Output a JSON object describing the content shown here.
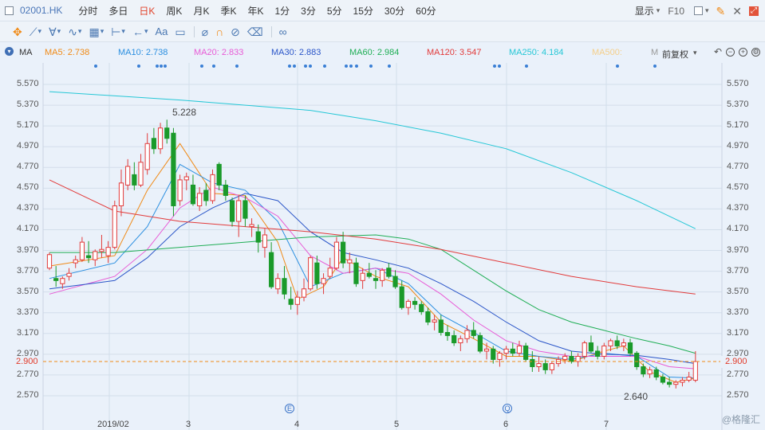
{
  "header": {
    "stock_code": "02001.HK",
    "tabs": [
      {
        "label": "分时",
        "active": false
      },
      {
        "label": "多日",
        "active": false
      },
      {
        "label": "日K",
        "active": true
      },
      {
        "label": "周K",
        "active": false
      },
      {
        "label": "月K",
        "active": false
      },
      {
        "label": "季K",
        "active": false
      },
      {
        "label": "年K",
        "active": false
      },
      {
        "label": "1分",
        "active": false
      },
      {
        "label": "3分",
        "active": false
      },
      {
        "label": "5分",
        "active": false
      },
      {
        "label": "15分",
        "active": false
      },
      {
        "label": "30分",
        "active": false
      },
      {
        "label": "60分",
        "active": false
      }
    ],
    "display_label": "显示",
    "f10_label": "F10"
  },
  "toolbar": {
    "font_label": "Aa"
  },
  "indicator": {
    "name": "MA",
    "adjust_label": "前复权",
    "items": [
      {
        "label": "MA5: 2.738",
        "color": "#f08a16"
      },
      {
        "label": "MA10: 2.738",
        "color": "#2b8fe0"
      },
      {
        "label": "MA20: 2.833",
        "color": "#e85bd6"
      },
      {
        "label": "MA30: 2.883",
        "color": "#2a55c8"
      },
      {
        "label": "MA60: 2.984",
        "color": "#1fae55"
      },
      {
        "label": "MA120: 3.547",
        "color": "#e23b3b"
      },
      {
        "label": "MA250: 4.184",
        "color": "#25c7d6"
      },
      {
        "label": "MA500:",
        "color": "#f5cf8a"
      },
      {
        "label": "M",
        "color": "#999999"
      }
    ]
  },
  "chart_data": {
    "type": "candlestick",
    "y_ticks": [
      "5.570",
      "5.370",
      "5.170",
      "4.970",
      "4.770",
      "4.570",
      "4.370",
      "4.170",
      "3.970",
      "3.770",
      "3.570",
      "3.370",
      "3.170",
      "2.970",
      "2.770",
      "2.570"
    ],
    "x_labels": [
      "2019/02",
      "3",
      "4",
      "5",
      "6",
      "7"
    ],
    "current_price": "2.900",
    "high_label": "5.228",
    "low_label": "2.640",
    "ylim": [
      2.48,
      5.68
    ],
    "event_markers": [
      "E",
      "Q"
    ],
    "colors": {
      "up": "#e23b3b",
      "down": "#1a9a2a"
    },
    "ohlc": [
      [
        3.8,
        3.95,
        3.78,
        3.93
      ],
      [
        3.7,
        3.82,
        3.62,
        3.68
      ],
      [
        3.65,
        3.72,
        3.6,
        3.7
      ],
      [
        3.72,
        3.8,
        3.68,
        3.75
      ],
      [
        3.85,
        3.92,
        3.8,
        3.88
      ],
      [
        3.88,
        4.1,
        3.86,
        4.05
      ],
      [
        3.92,
        4.06,
        3.85,
        3.9
      ],
      [
        3.88,
        3.98,
        3.82,
        3.96
      ],
      [
        3.96,
        4.12,
        3.9,
        3.98
      ],
      [
        3.92,
        4.06,
        3.85,
        4.0
      ],
      [
        4.0,
        4.45,
        3.98,
        4.4
      ],
      [
        4.4,
        4.75,
        4.3,
        4.62
      ],
      [
        4.6,
        4.85,
        4.55,
        4.78
      ],
      [
        4.7,
        4.82,
        4.55,
        4.6
      ],
      [
        4.6,
        4.9,
        4.58,
        4.82
      ],
      [
        4.75,
        5.1,
        4.7,
        5.0
      ],
      [
        5.05,
        5.15,
        4.9,
        4.95
      ],
      [
        4.95,
        5.2,
        4.9,
        5.15
      ],
      [
        5.15,
        5.23,
        5.0,
        5.05
      ],
      [
        5.1,
        5.15,
        4.3,
        4.4
      ],
      [
        4.45,
        4.7,
        4.4,
        4.65
      ],
      [
        4.65,
        4.72,
        4.55,
        4.68
      ],
      [
        4.6,
        4.7,
        4.4,
        4.42
      ],
      [
        4.4,
        4.58,
        4.35,
        4.52
      ],
      [
        4.55,
        4.62,
        4.4,
        4.45
      ],
      [
        4.45,
        4.75,
        4.42,
        4.7
      ],
      [
        4.8,
        4.82,
        4.55,
        4.6
      ],
      [
        4.6,
        4.65,
        4.45,
        4.5
      ],
      [
        4.45,
        4.48,
        4.2,
        4.25
      ],
      [
        4.25,
        4.5,
        4.1,
        4.45
      ],
      [
        4.45,
        4.5,
        4.2,
        4.28
      ],
      [
        4.2,
        4.28,
        4.1,
        4.22
      ],
      [
        4.15,
        4.22,
        3.95,
        4.05
      ],
      [
        4.0,
        4.18,
        3.9,
        4.12
      ],
      [
        3.95,
        4.05,
        3.6,
        3.62
      ],
      [
        3.6,
        3.75,
        3.55,
        3.7
      ],
      [
        3.7,
        3.82,
        3.5,
        3.55
      ],
      [
        3.5,
        3.62,
        3.4,
        3.45
      ],
      [
        3.45,
        3.58,
        3.35,
        3.52
      ],
      [
        3.52,
        3.7,
        3.48,
        3.6
      ],
      [
        3.6,
        3.92,
        3.58,
        3.9
      ],
      [
        3.85,
        3.92,
        3.6,
        3.65
      ],
      [
        3.65,
        3.75,
        3.55,
        3.7
      ],
      [
        3.72,
        3.9,
        3.7,
        3.8
      ],
      [
        3.8,
        4.1,
        3.78,
        4.05
      ],
      [
        4.05,
        4.15,
        3.8,
        3.85
      ],
      [
        3.85,
        3.95,
        3.75,
        3.88
      ],
      [
        3.85,
        3.9,
        3.62,
        3.65
      ],
      [
        3.68,
        3.8,
        3.6,
        3.75
      ],
      [
        3.75,
        3.85,
        3.7,
        3.72
      ],
      [
        3.7,
        3.78,
        3.6,
        3.68
      ],
      [
        3.68,
        3.8,
        3.62,
        3.78
      ],
      [
        3.8,
        3.85,
        3.7,
        3.72
      ],
      [
        3.72,
        3.78,
        3.6,
        3.62
      ],
      [
        3.62,
        3.68,
        3.4,
        3.42
      ],
      [
        3.42,
        3.5,
        3.35,
        3.48
      ],
      [
        3.48,
        3.52,
        3.4,
        3.45
      ],
      [
        3.45,
        3.48,
        3.35,
        3.38
      ],
      [
        3.38,
        3.42,
        3.25,
        3.28
      ],
      [
        3.28,
        3.35,
        3.2,
        3.3
      ],
      [
        3.3,
        3.35,
        3.15,
        3.18
      ],
      [
        3.18,
        3.25,
        3.1,
        3.15
      ],
      [
        3.15,
        3.2,
        3.05,
        3.08
      ],
      [
        3.08,
        3.15,
        3.0,
        3.12
      ],
      [
        3.12,
        3.25,
        3.08,
        3.2
      ],
      [
        3.2,
        3.28,
        3.12,
        3.15
      ],
      [
        3.15,
        3.18,
        2.98,
        3.0
      ],
      [
        3.0,
        3.08,
        2.92,
        3.02
      ],
      [
        3.02,
        3.05,
        2.88,
        2.92
      ],
      [
        2.92,
        3.0,
        2.85,
        2.98
      ],
      [
        2.98,
        3.05,
        2.92,
        3.02
      ],
      [
        3.02,
        3.08,
        2.95,
        2.98
      ],
      [
        2.98,
        3.1,
        2.95,
        3.05
      ],
      [
        3.05,
        3.08,
        2.9,
        2.92
      ],
      [
        2.92,
        3.0,
        2.8,
        2.85
      ],
      [
        2.85,
        2.95,
        2.8,
        2.88
      ],
      [
        2.88,
        2.92,
        2.78,
        2.82
      ],
      [
        2.82,
        2.9,
        2.78,
        2.88
      ],
      [
        2.88,
        2.95,
        2.85,
        2.92
      ],
      [
        2.92,
        2.98,
        2.88,
        2.95
      ],
      [
        2.95,
        3.0,
        2.88,
        2.9
      ],
      [
        2.9,
        2.98,
        2.85,
        2.95
      ],
      [
        2.95,
        3.1,
        2.92,
        3.08
      ],
      [
        3.08,
        3.15,
        2.98,
        3.0
      ],
      [
        3.0,
        3.05,
        2.92,
        2.95
      ],
      [
        2.95,
        3.08,
        2.92,
        3.05
      ],
      [
        3.05,
        3.12,
        3.0,
        3.1
      ],
      [
        3.1,
        3.15,
        3.02,
        3.05
      ],
      [
        3.05,
        3.12,
        3.0,
        3.08
      ],
      [
        3.08,
        3.12,
        2.95,
        2.98
      ],
      [
        2.98,
        3.0,
        2.82,
        2.85
      ],
      [
        2.85,
        2.88,
        2.75,
        2.78
      ],
      [
        2.78,
        2.85,
        2.74,
        2.82
      ],
      [
        2.82,
        2.85,
        2.72,
        2.75
      ],
      [
        2.75,
        2.78,
        2.68,
        2.7
      ],
      [
        2.7,
        2.75,
        2.65,
        2.68
      ],
      [
        2.68,
        2.72,
        2.64,
        2.7
      ],
      [
        2.7,
        2.75,
        2.66,
        2.72
      ],
      [
        2.72,
        2.8,
        2.7,
        2.75
      ],
      [
        2.72,
        3.0,
        2.7,
        2.9
      ]
    ],
    "ma_lines": [
      {
        "name": "MA5",
        "color": "#f08a16",
        "points": [
          [
            0,
            3.82
          ],
          [
            10,
            3.92
          ],
          [
            15,
            4.55
          ],
          [
            20,
            5.0
          ],
          [
            25,
            4.52
          ],
          [
            30,
            4.5
          ],
          [
            35,
            4.05
          ],
          [
            38,
            3.5
          ],
          [
            42,
            3.62
          ],
          [
            45,
            3.9
          ],
          [
            50,
            3.72
          ],
          [
            55,
            3.62
          ],
          [
            60,
            3.28
          ],
          [
            65,
            3.12
          ],
          [
            70,
            2.95
          ],
          [
            75,
            2.95
          ],
          [
            80,
            2.9
          ],
          [
            85,
            3.0
          ],
          [
            88,
            3.05
          ],
          [
            92,
            2.8
          ],
          [
            96,
            2.7
          ],
          [
            99,
            2.74
          ]
        ]
      },
      {
        "name": "MA10",
        "color": "#2b8fe0",
        "points": [
          [
            0,
            3.7
          ],
          [
            10,
            3.85
          ],
          [
            15,
            4.2
          ],
          [
            20,
            4.8
          ],
          [
            25,
            4.62
          ],
          [
            30,
            4.55
          ],
          [
            35,
            4.25
          ],
          [
            40,
            3.62
          ],
          [
            45,
            3.75
          ],
          [
            50,
            3.8
          ],
          [
            55,
            3.65
          ],
          [
            60,
            3.35
          ],
          [
            65,
            3.18
          ],
          [
            70,
            3.0
          ],
          [
            75,
            2.95
          ],
          [
            80,
            2.92
          ],
          [
            85,
            2.98
          ],
          [
            90,
            2.95
          ],
          [
            95,
            2.75
          ],
          [
            99,
            2.74
          ]
        ]
      },
      {
        "name": "MA20",
        "color": "#e85bd6",
        "points": [
          [
            0,
            3.55
          ],
          [
            10,
            3.72
          ],
          [
            15,
            3.98
          ],
          [
            20,
            4.38
          ],
          [
            25,
            4.58
          ],
          [
            30,
            4.48
          ],
          [
            35,
            4.3
          ],
          [
            40,
            3.92
          ],
          [
            45,
            3.75
          ],
          [
            50,
            3.8
          ],
          [
            55,
            3.75
          ],
          [
            60,
            3.55
          ],
          [
            65,
            3.3
          ],
          [
            70,
            3.1
          ],
          [
            75,
            3.0
          ],
          [
            80,
            2.95
          ],
          [
            85,
            2.95
          ],
          [
            90,
            2.95
          ],
          [
            95,
            2.85
          ],
          [
            99,
            2.83
          ]
        ]
      },
      {
        "name": "MA30",
        "color": "#2a55c8",
        "points": [
          [
            0,
            3.6
          ],
          [
            10,
            3.68
          ],
          [
            15,
            3.9
          ],
          [
            20,
            4.2
          ],
          [
            25,
            4.38
          ],
          [
            30,
            4.52
          ],
          [
            35,
            4.45
          ],
          [
            40,
            4.15
          ],
          [
            45,
            3.95
          ],
          [
            50,
            3.88
          ],
          [
            55,
            3.8
          ],
          [
            60,
            3.65
          ],
          [
            65,
            3.48
          ],
          [
            70,
            3.28
          ],
          [
            75,
            3.1
          ],
          [
            80,
            3.0
          ],
          [
            85,
            2.97
          ],
          [
            90,
            2.96
          ],
          [
            95,
            2.92
          ],
          [
            99,
            2.88
          ]
        ]
      },
      {
        "name": "MA60",
        "color": "#1fae55",
        "points": [
          [
            0,
            3.95
          ],
          [
            10,
            3.95
          ],
          [
            20,
            4.0
          ],
          [
            30,
            4.05
          ],
          [
            40,
            4.1
          ],
          [
            50,
            4.12
          ],
          [
            55,
            4.08
          ],
          [
            60,
            3.98
          ],
          [
            65,
            3.78
          ],
          [
            70,
            3.58
          ],
          [
            75,
            3.4
          ],
          [
            80,
            3.28
          ],
          [
            85,
            3.2
          ],
          [
            90,
            3.12
          ],
          [
            95,
            3.05
          ],
          [
            99,
            2.98
          ]
        ]
      },
      {
        "name": "MA120",
        "color": "#e23b3b",
        "points": [
          [
            0,
            4.65
          ],
          [
            10,
            4.35
          ],
          [
            20,
            4.25
          ],
          [
            30,
            4.2
          ],
          [
            40,
            4.15
          ],
          [
            50,
            4.08
          ],
          [
            60,
            3.98
          ],
          [
            70,
            3.85
          ],
          [
            80,
            3.72
          ],
          [
            90,
            3.62
          ],
          [
            99,
            3.55
          ]
        ]
      },
      {
        "name": "MA250",
        "color": "#25c7d6",
        "points": [
          [
            0,
            5.5
          ],
          [
            20,
            5.42
          ],
          [
            40,
            5.32
          ],
          [
            50,
            5.22
          ],
          [
            60,
            5.1
          ],
          [
            70,
            4.95
          ],
          [
            80,
            4.72
          ],
          [
            90,
            4.45
          ],
          [
            99,
            4.18
          ]
        ]
      }
    ]
  },
  "watermark": "@格隆汇"
}
